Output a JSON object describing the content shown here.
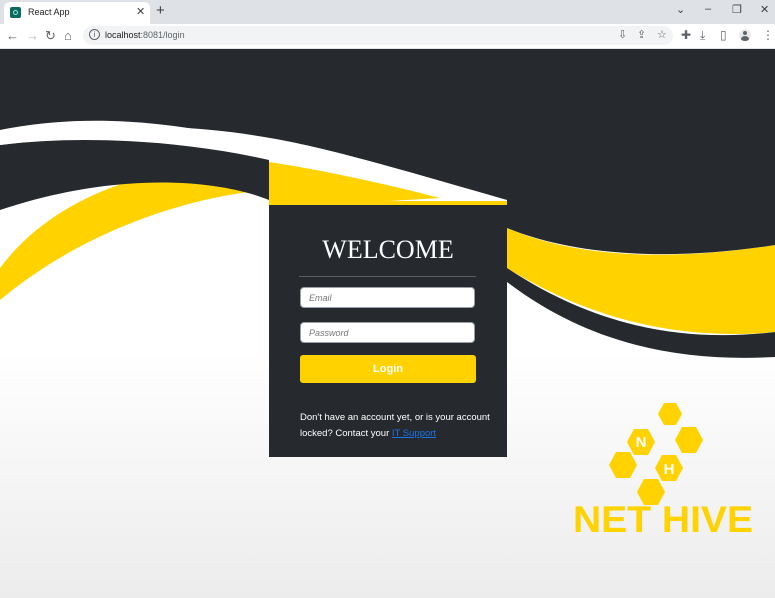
{
  "browser": {
    "tab_title": "React App",
    "tab_close": "✕",
    "new_tab": "+",
    "url_host": "localhost",
    "url_path": ":8081/login",
    "window_controls": [
      "chevron-down-icon",
      "minimize-icon",
      "restore-icon",
      "close-icon"
    ]
  },
  "login": {
    "title": "WELCOME",
    "email_placeholder": "Email",
    "password_placeholder": "Password",
    "submit_label": "Login",
    "note_text": "Don't have an account yet, or is your account locked? Contact your ",
    "note_link": "IT Support"
  },
  "logo": {
    "text": "NET HIVE",
    "hex_letters": [
      "N",
      "H"
    ]
  },
  "colors": {
    "accent": "#ffd200",
    "dark": "#262a2e",
    "link": "#1a73e8"
  }
}
